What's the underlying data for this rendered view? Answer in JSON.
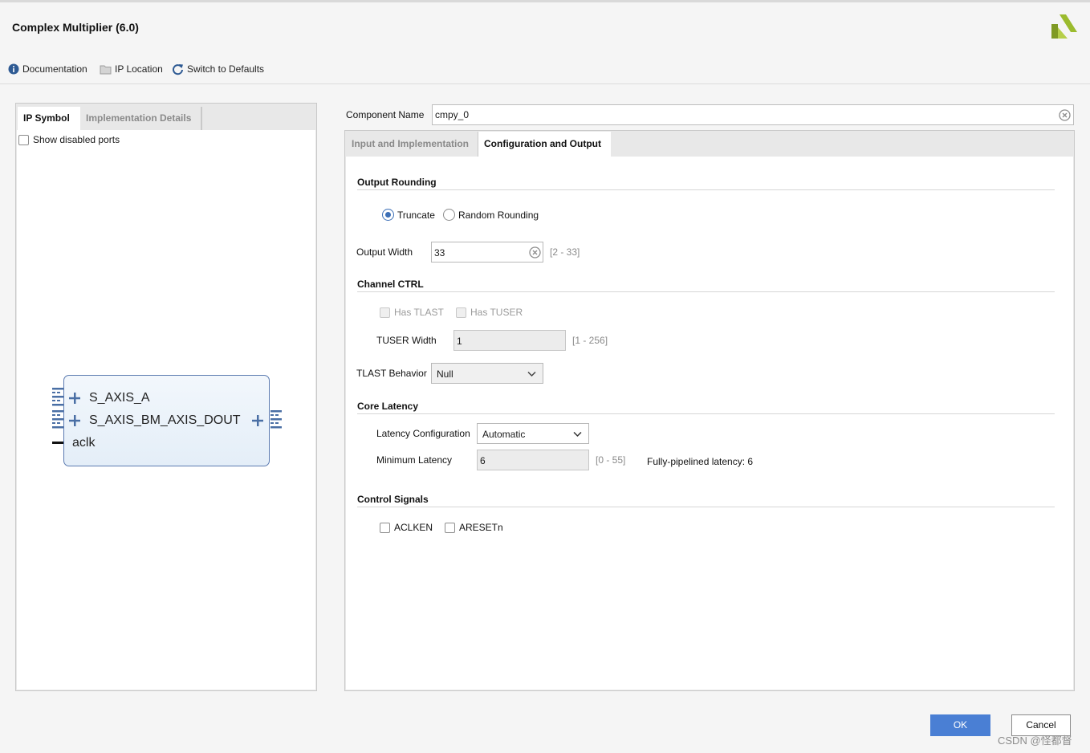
{
  "window": {
    "title": "Complex Multiplier (6.0)"
  },
  "toolbar": {
    "documentation": "Documentation",
    "ip_location": "IP Location",
    "switch_defaults": "Switch to Defaults"
  },
  "left_panel": {
    "tabs": [
      "IP Symbol",
      "Implementation Details"
    ],
    "show_disabled_ports": "Show disabled ports",
    "symbol": {
      "inputs": [
        "S_AXIS_A",
        "S_AXIS_BM_AXIS_DOUT",
        "aclk"
      ]
    }
  },
  "component": {
    "label": "Component Name",
    "value": "cmpy_0"
  },
  "right_panel": {
    "tabs": [
      "Input and Implementation",
      "Configuration and Output"
    ],
    "output_rounding": {
      "title": "Output Rounding",
      "truncate": "Truncate",
      "random_rounding": "Random Rounding",
      "selected": "Truncate",
      "output_width_label": "Output Width",
      "output_width_value": "33",
      "output_width_range": "[2 - 33]"
    },
    "channel_ctrl": {
      "title": "Channel CTRL",
      "has_tlast": "Has TLAST",
      "has_tuser": "Has TUSER",
      "tuser_width_label": "TUSER Width",
      "tuser_width_value": "1",
      "tuser_width_range": "[1 - 256]",
      "tlast_behavior_label": "TLAST Behavior",
      "tlast_behavior_value": "Null"
    },
    "core_latency": {
      "title": "Core Latency",
      "latency_config_label": "Latency Configuration",
      "latency_config_value": "Automatic",
      "min_latency_label": "Minimum Latency",
      "min_latency_value": "6",
      "min_latency_range": "[0 - 55]",
      "fully_pipelined": "Fully-pipelined latency: 6"
    },
    "control_signals": {
      "title": "Control Signals",
      "aclken": "ACLKEN",
      "aresetn": "ARESETn"
    }
  },
  "buttons": {
    "ok": "OK",
    "cancel": "Cancel"
  },
  "watermark": "CSDN @怪都督",
  "colors": {
    "accent": "#4a7fd4",
    "logo_green": "#9bbb2e",
    "port_blue": "#4a6fa5"
  }
}
